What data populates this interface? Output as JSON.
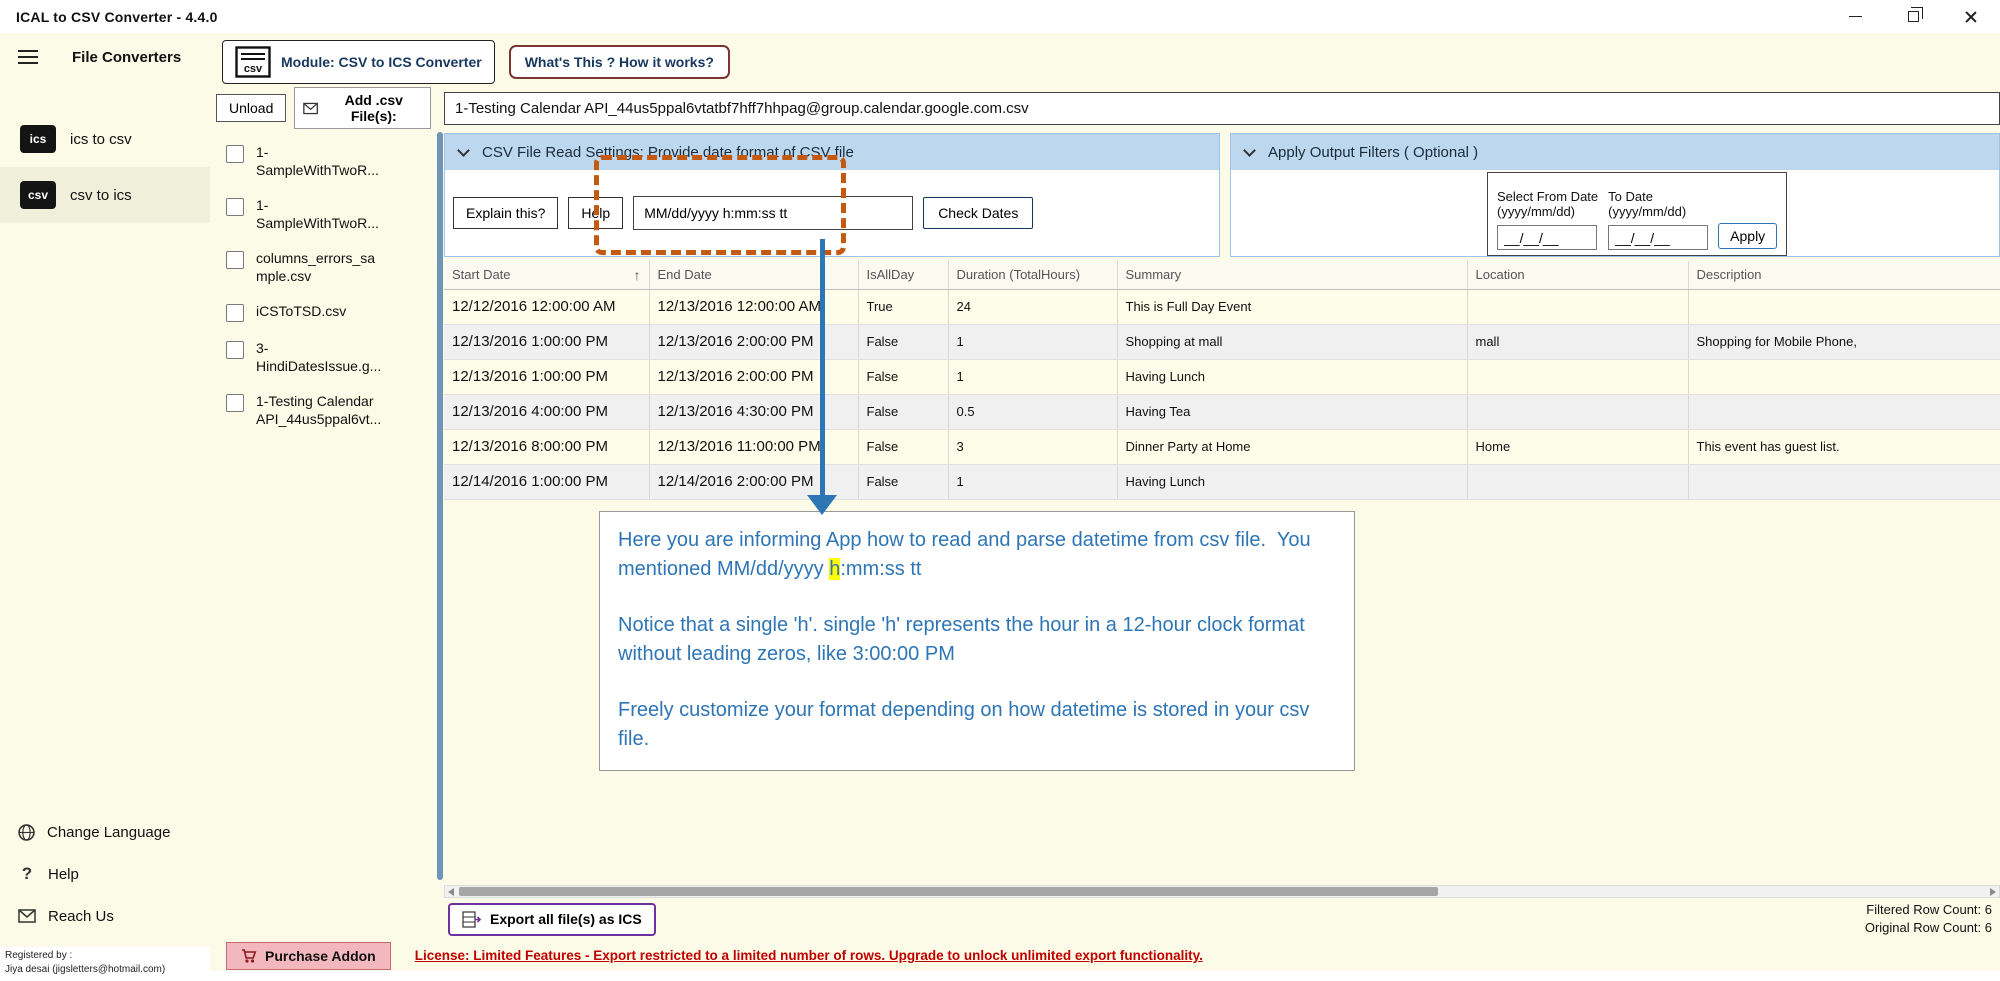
{
  "window": {
    "title": "ICAL to CSV Converter -  4.4.0"
  },
  "colors": {
    "accent_blue": "#2E75B6",
    "panel_header_blue": "#BDD7EE",
    "highlight_orange": "#C45911",
    "highlight_yellow": "#FFFF00",
    "export_purple": "#7030A0",
    "license_red": "#C00000",
    "background_cream": "#FBFBE7"
  },
  "sidebar": {
    "title": "File Converters",
    "items": [
      {
        "label": "ics to csv",
        "icon_text": "ics"
      },
      {
        "label": "csv to ics",
        "icon_text": "csv"
      }
    ],
    "footer_items": [
      {
        "label": "Change Language"
      },
      {
        "label": "Help",
        "icon_text": "?"
      },
      {
        "label": "Reach Us"
      }
    ],
    "registered_by": "Registered by :",
    "registered_user": "Jiya desai (jigsletters@hotmail.com)"
  },
  "module_bar": {
    "csv_icon_text": "csv",
    "module_label": "Module: CSV to ICS Converter",
    "whats_this_label": "What's This ? How it works?"
  },
  "file_panel": {
    "unload_label": "Unload",
    "add_label": "Add .csv File(s):",
    "files": [
      {
        "name": "1-\nSampleWithTwoR..."
      },
      {
        "name": "1-\nSampleWithTwoR..."
      },
      {
        "name": "columns_errors_sa\nmple.csv"
      },
      {
        "name": "iCSToTSD.csv"
      },
      {
        "name": "3-\nHindiDatesIssue.g..."
      },
      {
        "name": "1-Testing Calendar\nAPI_44us5ppal6vt..."
      }
    ]
  },
  "main": {
    "filename": "1-Testing Calendar API_44us5ppal6vtatbf7hff7hhpag@group.calendar.google.com.csv",
    "read_settings": {
      "header": "CSV File Read Settings: Provide date format of CSV file",
      "explain_label": "Explain this?",
      "help_label": "Help",
      "format_value": "MM/dd/yyyy h:mm:ss tt",
      "check_dates_label": "Check Dates"
    },
    "filters": {
      "header": "Apply Output Filters ( Optional )",
      "from_label": "Select From Date",
      "from_sub": "(yyyy/mm/dd)",
      "to_label": "To Date",
      "to_sub": "(yyyy/mm/dd)",
      "from_value": "__/__/__",
      "to_value": "__/__/__",
      "apply_label": "Apply"
    },
    "table": {
      "sort_indicator": "↑",
      "columns": [
        "Start Date",
        "End Date",
        "IsAllDay",
        "Duration (TotalHours)",
        "Summary",
        "Location",
        "Description"
      ],
      "rows": [
        {
          "start": "12/12/2016 12:00:00 AM",
          "end": "12/13/2016 12:00:00 AM",
          "allday": "True",
          "duration": "24",
          "summary": "This is Full Day Event",
          "location": "",
          "description": ""
        },
        {
          "start": "12/13/2016 1:00:00 PM",
          "end": "12/13/2016 2:00:00 PM",
          "allday": "False",
          "duration": "1",
          "summary": "Shopping at mall",
          "location": "mall",
          "description": "Shopping for Mobile Phone,"
        },
        {
          "start": "12/13/2016 1:00:00 PM",
          "end": "12/13/2016 2:00:00 PM",
          "allday": "False",
          "duration": "1",
          "summary": "Having Lunch",
          "location": "",
          "description": ""
        },
        {
          "start": "12/13/2016 4:00:00 PM",
          "end": "12/13/2016 4:30:00 PM",
          "allday": "False",
          "duration": "0.5",
          "summary": "Having Tea",
          "location": "",
          "description": ""
        },
        {
          "start": "12/13/2016 8:00:00 PM",
          "end": "12/13/2016 11:00:00 PM",
          "allday": "False",
          "duration": "3",
          "summary": "Dinner Party at Home",
          "location": "Home",
          "description": "This event has guest list."
        },
        {
          "start": "12/14/2016 1:00:00 PM",
          "end": "12/14/2016 2:00:00 PM",
          "allday": "False",
          "duration": "1",
          "summary": "Having Lunch",
          "location": "",
          "description": ""
        }
      ]
    },
    "annotation": {
      "p1_before": "Here you are informing App how to read and parse datetime from csv file.  You mentioned MM/dd/yyyy ",
      "p1_highlight": "h",
      "p1_after": ":mm:ss tt",
      "p2": "Notice that a single 'h'. single 'h' represents the hour in a 12-hour clock format without leading zeros, like 3:00:00 PM",
      "p3": "Freely customize your format depending on how datetime is stored in your csv file."
    },
    "export_label": "Export all file(s) as ICS",
    "filtered_count": "Filtered Row Count: 6",
    "original_count": "Original Row Count: 6"
  },
  "license_bar": {
    "purchase_label": "Purchase Addon",
    "license_text": "License: Limited Features - Export restricted to a limited number of rows. Upgrade to unlock unlimited export functionality."
  }
}
